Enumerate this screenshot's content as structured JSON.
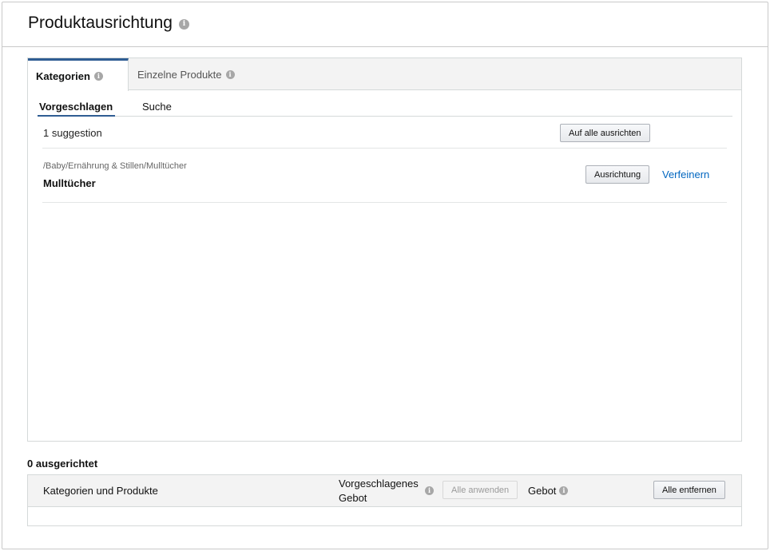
{
  "header": {
    "title": "Produktausrichtung"
  },
  "tabs": [
    {
      "label": "Kategorien",
      "active": true
    },
    {
      "label": "Einzelne Produkte",
      "active": false
    }
  ],
  "subtabs": [
    {
      "label": "Vorgeschlagen",
      "active": true
    },
    {
      "label": "Suche",
      "active": false
    }
  ],
  "suggestions": {
    "count_label": "1 suggestion",
    "target_all_label": "Auf alle ausrichten",
    "items": [
      {
        "path": "/Baby/Ernährung & Stillen/Mulltücher",
        "name": "Mulltücher",
        "target_label": "Ausrichtung",
        "refine_label": "Verfeinern"
      }
    ]
  },
  "targeted": {
    "label": "0 ausgerichtet",
    "columns": {
      "name": "Kategorien und Produkte",
      "suggested_bid_line1": "Vorgeschlagenes",
      "suggested_bid_line2": "Gebot",
      "apply_all": "Alle anwenden",
      "bid": "Gebot",
      "remove_all": "Alle entfernen"
    },
    "rows": []
  },
  "colors": {
    "accent": "#2f5d93",
    "link": "#0066c0",
    "info_icon": "#a7a7a7"
  }
}
